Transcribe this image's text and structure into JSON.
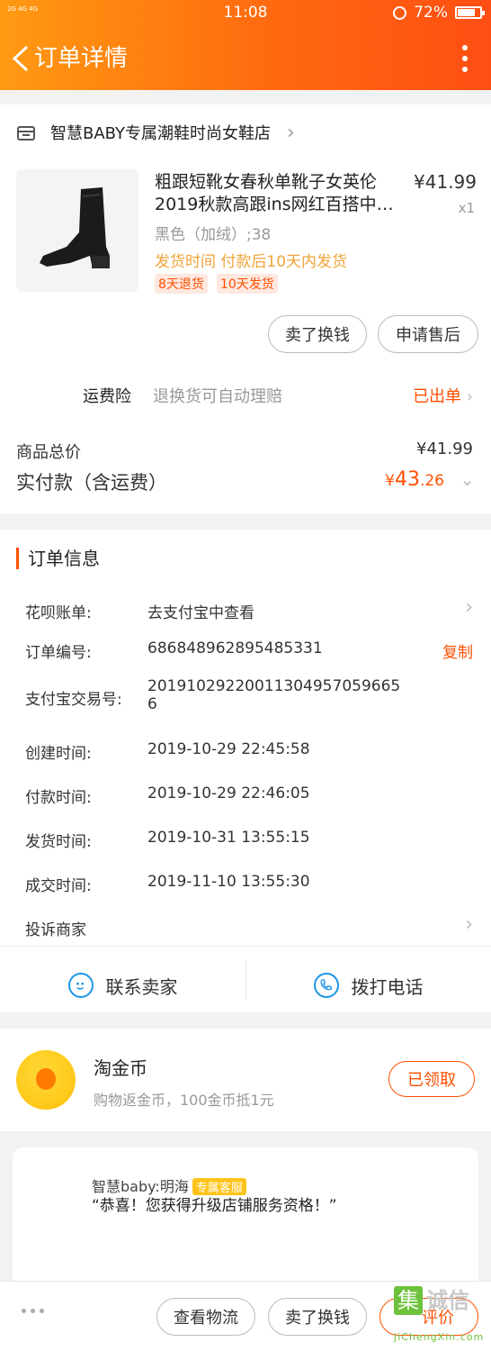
{
  "status_bar": {
    "signal": "2G 4G 4G",
    "time": "11:08",
    "battery": "72%",
    "battery_level": 0.72
  },
  "header": {
    "title": "订单详情"
  },
  "shop": {
    "name": "智慧BABY专属潮鞋时尚女鞋店"
  },
  "product": {
    "title": "粗跟短靴女春秋单靴子女英伦2019秋款高跟ins网红百搭中…",
    "price": "¥41.99",
    "quantity": "x1",
    "variant": "黑色（加绒）;38",
    "shipping_time": "发货时间  付款后10天内发货",
    "tags": [
      "8天退货",
      "10天发货"
    ]
  },
  "actions": {
    "exchange": "卖了换钱",
    "after_sale": "申请售后"
  },
  "insurance": {
    "label": "运费险",
    "desc": "退换货可自动理赔",
    "status": "已出单"
  },
  "totals": {
    "goods_label": "商品总价",
    "goods_value": "¥41.99",
    "paid_label": "实付款（含运费）",
    "paid_currency": "¥",
    "paid_int": "43",
    "paid_dec": ".26"
  },
  "order_info": {
    "title": "订单信息",
    "rows": [
      {
        "label": "花呗账单:",
        "value": "去支付宝中查看"
      },
      {
        "label": "订单编号:",
        "value": "686848962895485331",
        "action": "复制"
      },
      {
        "label": "支付宝交易号:",
        "value": "20191029220011304957059665",
        "value2": "6"
      },
      {
        "label": "创建时间:",
        "value": "2019-10-29 22:45:58"
      },
      {
        "label": "付款时间:",
        "value": "2019-10-29 22:46:05"
      },
      {
        "label": "发货时间:",
        "value": "2019-10-31 13:55:15"
      },
      {
        "label": "成交时间:",
        "value": "2019-11-10 13:55:30"
      },
      {
        "label": "投诉商家",
        "value": ""
      }
    ]
  },
  "contact": {
    "seller": "联系卖家",
    "phone": "拨打电话"
  },
  "coins": {
    "title": "淘金币",
    "desc": "购物返金币，100金币抵1元",
    "button": "已领取"
  },
  "chat": {
    "name": "智慧baby:明海",
    "badge": "专属客服",
    "message": "“恭喜！您获得升级店铺服务资格！”"
  },
  "bottom_bar": {
    "logistics": "查看物流",
    "exchange": "卖了换钱",
    "review": "评价"
  },
  "watermark": {
    "char": "集",
    "text": "诚信",
    "url": "JiChengXin.com"
  },
  "colors": {
    "accent": "#ff5000",
    "header_start": "#ff9a12",
    "header_end": "#ff4e13",
    "icon_blue": "#1e96e6"
  }
}
